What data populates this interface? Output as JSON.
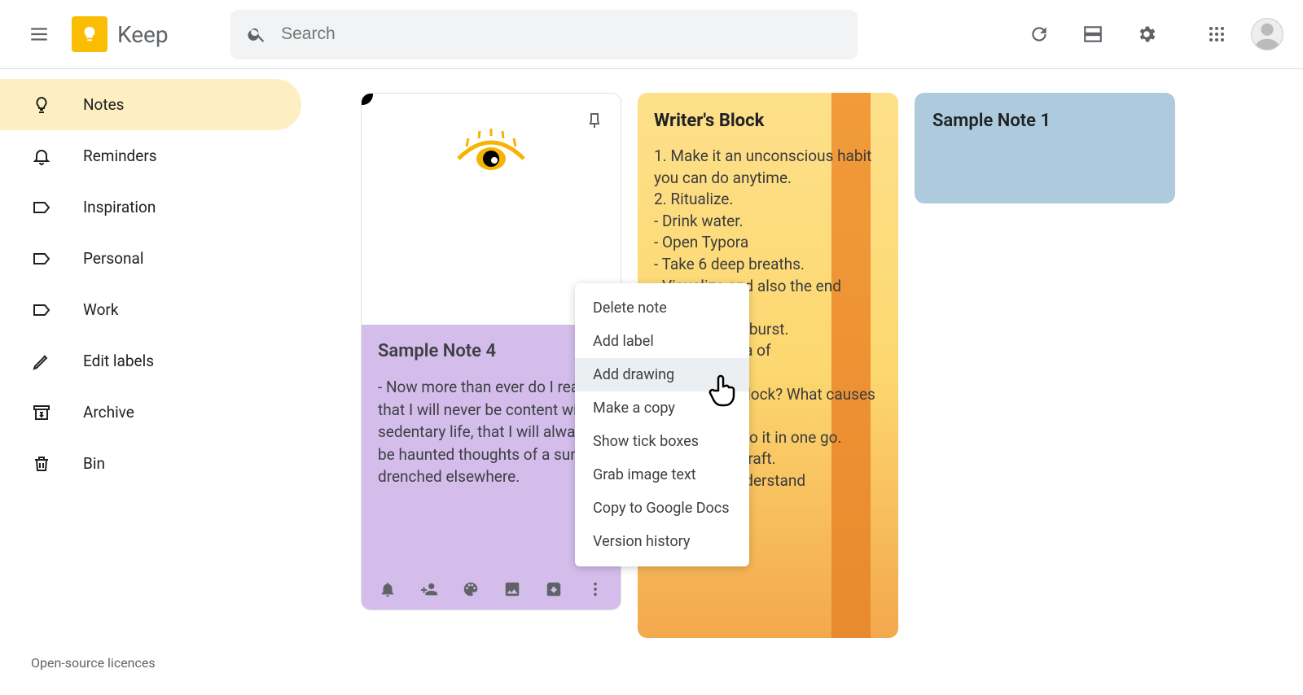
{
  "header": {
    "appName": "Keep",
    "searchPlaceholder": "Search"
  },
  "sidebar": {
    "items": [
      {
        "label": "Notes",
        "icon": "lightbulb",
        "active": true
      },
      {
        "label": "Reminders",
        "icon": "bell",
        "active": false
      },
      {
        "label": "Inspiration",
        "icon": "label",
        "active": false
      },
      {
        "label": "Personal",
        "icon": "label",
        "active": false
      },
      {
        "label": "Work",
        "icon": "label",
        "active": false
      },
      {
        "label": "Edit labels",
        "icon": "pencil",
        "active": false
      },
      {
        "label": "Archive",
        "icon": "archive",
        "active": false
      },
      {
        "label": "Bin",
        "icon": "trash",
        "active": false
      }
    ],
    "footer": "Open-source licences"
  },
  "notes": {
    "note4": {
      "title": "Sample Note 4",
      "body": "- Now more than ever do I realize that I will never be content with a sedentary life, that I will always be haunted thoughts of a sun-drenched elsewhere."
    },
    "note2": {
      "title": "Writer's Block",
      "body": "1. Make it an unconscious habit you can do anytime.\n2. Ritualize.\n- Drink water.\n- Open Typora\n- Take 6 deep breaths.\n- Visualize and also the end result.\n3. Do an hour burst.\n4. Anchor idea of\n\n5. The main block? What causes that?\n6. Laziness: Do it in one go.\n7. Very dirty draft.\n8. Want to understand\n..."
    },
    "note1": {
      "title": "Sample Note 1"
    }
  },
  "contextMenu": {
    "items": [
      "Delete note",
      "Add label",
      "Add drawing",
      "Make a copy",
      "Show tick boxes",
      "Grab image text",
      "Copy to Google Docs",
      "Version history"
    ],
    "hoveredIndex": 2
  }
}
